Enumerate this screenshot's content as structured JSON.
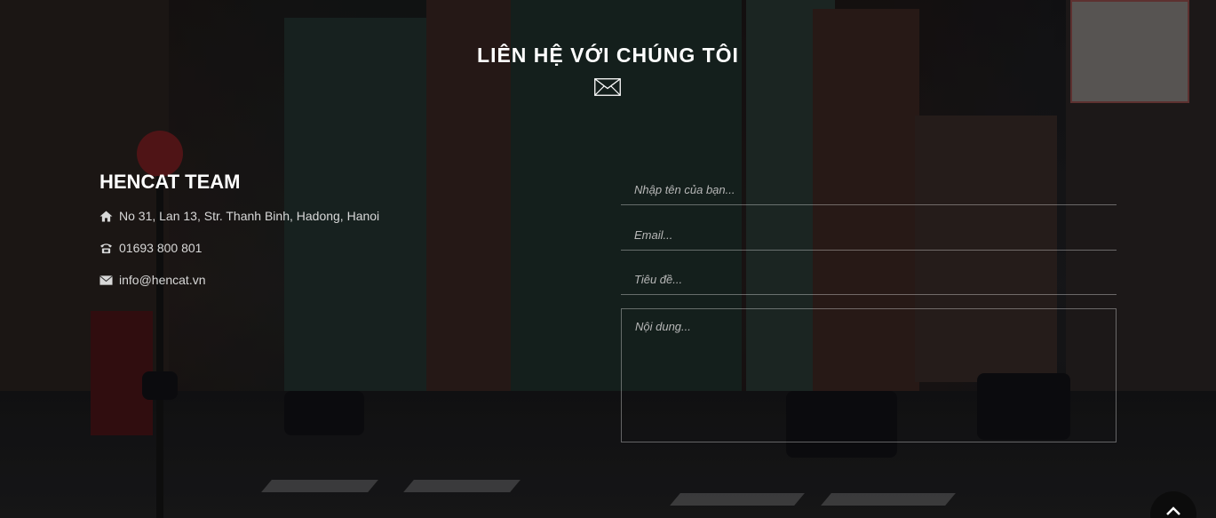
{
  "section": {
    "title": "LIÊN HỆ VỚI CHÚNG TÔI",
    "title_icon": "envelope-icon"
  },
  "team": {
    "name": "HENCAT TEAM",
    "address": "No 31, Lan 13, Str. Thanh Binh, Hadong, Hanoi",
    "address_icon": "home-icon",
    "phone": "01693 800 801",
    "phone_icon": "phone-icon",
    "email": "info@hencat.vn",
    "email_icon": "envelope-icon"
  },
  "form": {
    "name_placeholder": "Nhập tên của bạn...",
    "email_placeholder": "Email...",
    "subject_placeholder": "Tiêu đề...",
    "message_placeholder": "Nội dung..."
  },
  "scroll_top": {
    "icon": "chevron-up-icon"
  },
  "colors": {
    "text": "#ffffff",
    "muted_text": "#d8d8d8",
    "field_border": "rgba(255,255,255,0.35)"
  }
}
